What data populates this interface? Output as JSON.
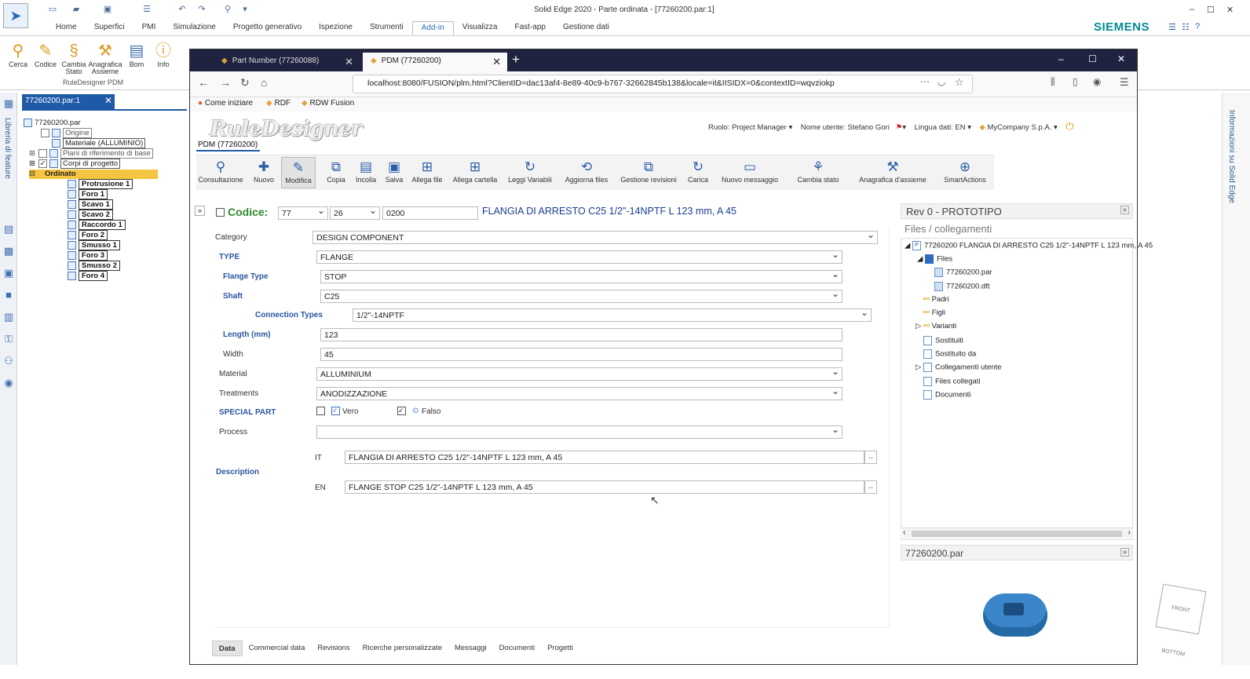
{
  "solidedge": {
    "title": "Solid Edge 2020 - Parte ordinata - [77260200.par:1]",
    "ribbon_tabs": [
      "Home",
      "Superfici",
      "PMI",
      "Simulazione",
      "Progetto generativo",
      "Ispezione",
      "Strumenti",
      "Add-in",
      "Visualizza",
      "Fast-app",
      "Gestione dati"
    ],
    "brand": "SIEMENS",
    "ribbon_buttons": [
      "Cerca",
      "Codice",
      "Cambia Stato",
      "Anagrafica Assieme",
      "Bom",
      "Info"
    ],
    "ribbon_group": "RuleDesigner PDM",
    "library_label": "Libreria di feature",
    "doc_tab": "77260200.par:1",
    "tree": {
      "root": "77260200.par",
      "origin": "Origine",
      "material": "Materiale (ALLUMINIO)",
      "planes": "Piani di riferimento di base",
      "bodies": "Corpi di progetto",
      "ordered": "Ordinato",
      "features": [
        "Protrusione 1",
        "Foro 1",
        "Scavo 1",
        "Scavo 2",
        "Raccordo 1",
        "Foro 2",
        "Smusso 1",
        "Foro 3",
        "Smusso 2",
        "Foro 4"
      ]
    },
    "right_strip_label": "Informazioni su Solid Edge"
  },
  "browser": {
    "tabs": [
      "Part Number (77260088)",
      "PDM (77260200)"
    ],
    "url": "localhost:8080/FUSION/plm.html?ClientID=dac13af4-8e89-40c9-b767-32662845b138&locale=it&IISIDX=0&contextID=wqvziokp",
    "bookmarks": [
      "Come iniziare",
      "RDF",
      "RDW Fusion"
    ]
  },
  "app": {
    "logo": "RuleDesigner",
    "pdm_tab": "PDM (77260200)",
    "user": {
      "role_label": "Ruolo:",
      "role": "Project Manager",
      "user_label": "Nome utente:",
      "user": "Stefano Gori",
      "lang_label": "Lingua dati:",
      "lang": "EN",
      "company": "MyCompany S.p.A."
    },
    "toolbar": [
      "Consultazione",
      "Nuovo",
      "Modifica",
      "Copia",
      "Incolla",
      "Salva",
      "Allega file",
      "Allega cartella",
      "Leggi Variabili",
      "Aggiorna files",
      "Gestione revisioni",
      "Carica",
      "Nuovo messaggio",
      "Cambia stato",
      "Anagrafica d'assieme",
      "SmartActions"
    ],
    "code": {
      "label": "Codice:",
      "part1": "77",
      "part2": "26",
      "part3": "0200",
      "description": "FLANGIA DI ARRESTO C25 1/2\"-14NPTF L 123 mm, A 45"
    },
    "form": {
      "category": {
        "label": "Category",
        "value": "DESIGN COMPONENT"
      },
      "type": {
        "label": "TYPE",
        "value": "FLANGE"
      },
      "flange_type": {
        "label": "Flange Type",
        "value": "STOP"
      },
      "shaft": {
        "label": "Shaft",
        "value": "C25"
      },
      "connection_types": {
        "label": "Connection Types",
        "value": "1/2\"-14NPTF"
      },
      "length": {
        "label": "Length (mm)",
        "value": "123"
      },
      "width": {
        "label": "Width",
        "value": "45"
      },
      "material": {
        "label": "Material",
        "value": "ALLUMINIUM"
      },
      "treatments": {
        "label": "Treatments",
        "value": "ANODIZZAZIONE"
      },
      "special_part": {
        "label": "SPECIAL PART",
        "vero": "Vero",
        "falso": "Falso"
      },
      "process": {
        "label": "Process",
        "value": ""
      },
      "description": {
        "label": "Description",
        "it_label": "IT",
        "it": "FLANGIA DI ARRESTO C25 1/2\"-14NPTF L 123 mm, A 45",
        "en_label": "EN",
        "en": "FLANGE STOP C25 1/2\"-14NPTF L 123 mm, A 45"
      }
    },
    "bottom_tabs": [
      "Data",
      "Commercial data",
      "Revisions",
      "Ricerche personalizzate",
      "Messaggi",
      "Documenti",
      "Progetti"
    ],
    "rev": "Rev 0 - PROTOTIPO",
    "files_title": "Files / collegamenti",
    "files_tree": {
      "root": "77260200 FLANGIA DI ARRESTO C25 1/2\"-14NPTF L 123 mm, A 45",
      "files": "Files",
      "file1": "77260200.par",
      "file2": "77260200.dft",
      "items": [
        "Padri",
        "Figli",
        "Varianti",
        "Sostituiti",
        "Sostituito da",
        "Collegamenti utente",
        "Files collegati",
        "Documenti"
      ]
    },
    "preview_title": "77260200.par",
    "cube_labels": [
      "FRONT",
      "BOTTOM"
    ]
  }
}
